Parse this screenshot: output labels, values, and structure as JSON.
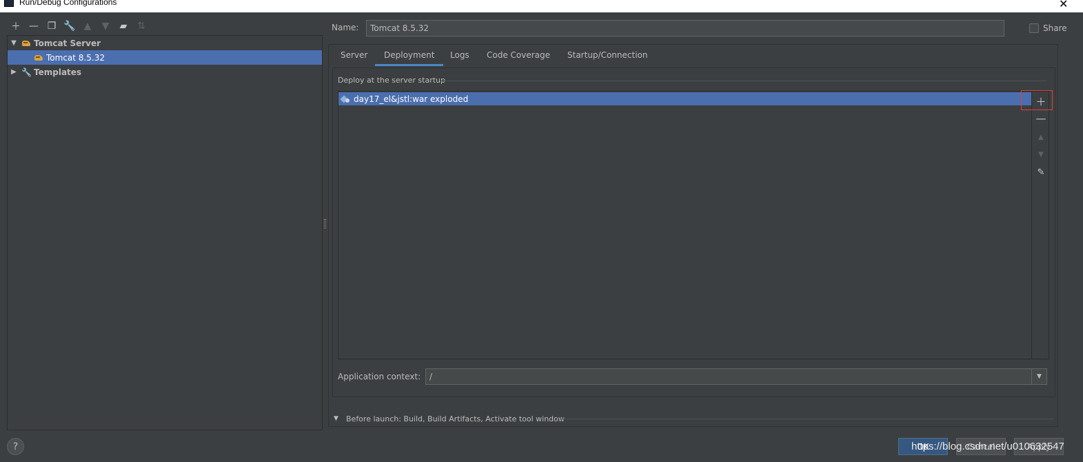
{
  "window": {
    "title": "Run/Debug Configurations",
    "close_glyph": "✕"
  },
  "toolbar": {
    "icons": [
      "add-icon",
      "remove-icon",
      "copy-icon",
      "wrench-icon",
      "move-up-icon",
      "move-down-icon",
      "folder-icon",
      "sort-icon"
    ]
  },
  "tree": {
    "items": [
      {
        "label": "Tomcat Server",
        "level": 0,
        "expanded": true,
        "icon": "tomcat-icon"
      },
      {
        "label": "Tomcat 8.5.32",
        "level": 1,
        "selected": true,
        "icon": "tomcat-icon"
      },
      {
        "label": "Templates",
        "level": 0,
        "expanded": false,
        "icon": "wrench-icon"
      }
    ]
  },
  "name": {
    "label": "Name:",
    "value": "Tomcat 8.5.32"
  },
  "share": {
    "label": "Share",
    "checked": false
  },
  "tabs": [
    {
      "label": "Server"
    },
    {
      "label": "Deployment",
      "active": true
    },
    {
      "label": "Logs"
    },
    {
      "label": "Code Coverage"
    },
    {
      "label": "Startup/Connection"
    }
  ],
  "deployment": {
    "group_title": "Deploy at the server startup",
    "items": [
      {
        "label": "day17_el&jstl:war exploded",
        "selected": true
      }
    ]
  },
  "app_context": {
    "label": "Application context:",
    "value": "/"
  },
  "before_launch": {
    "label": "Before launch: Build, Build Artifacts, Activate tool window"
  },
  "buttons": {
    "help": "?",
    "ok": "OK",
    "cancel": "Cancel",
    "apply": "Apply"
  },
  "watermark": "https://blog.csdn.net/u010632547",
  "colors": {
    "selection": "#4b6eaf",
    "background": "#3c3f41",
    "tab_underline": "#4a88c7",
    "highlight_box": "#e0403a",
    "ok_button": "#365880"
  }
}
